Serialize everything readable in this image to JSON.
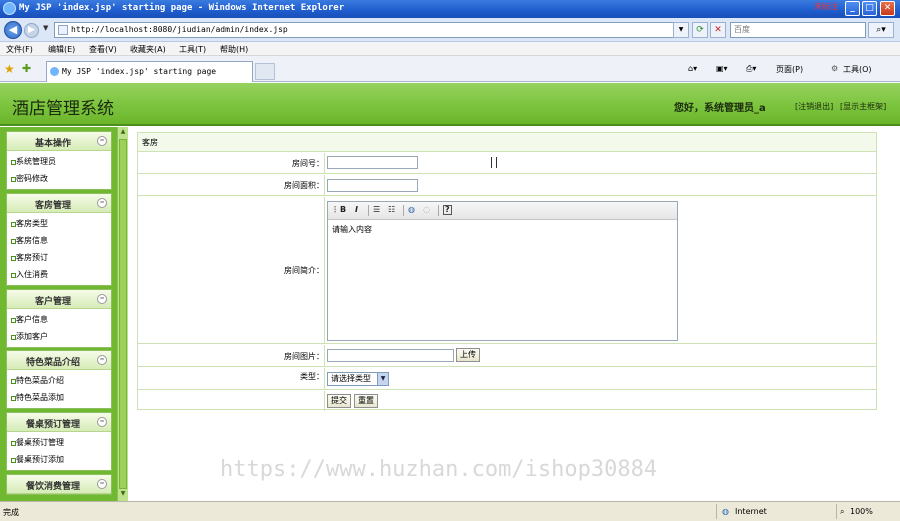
{
  "window": {
    "title": "My JSP 'index.jsp' starting page - Windows Internet Explorer",
    "corner_tag": "未标注",
    "controls": [
      "_",
      "□",
      "✕"
    ]
  },
  "browser": {
    "url": "http://localhost:8080/jiudian/admin/index.jsp",
    "search_placeholder": "百度",
    "menu": [
      "文件(F)",
      "编辑(E)",
      "查看(V)",
      "收藏夹(A)",
      "工具(T)",
      "帮助(H)"
    ],
    "tab_title": "My JSP 'index.jsp' starting page",
    "tools": {
      "page": "页面(P)",
      "tools": "工具(O)"
    },
    "status": {
      "left": "完成",
      "zone": "Internet",
      "zoom": "100%"
    }
  },
  "header": {
    "site_title": "酒店管理系统",
    "greeting": "您好，系统管理员_a",
    "logout": "[注销退出]",
    "main_frame": "[显示主框架]"
  },
  "sidebar": {
    "groups": [
      {
        "title": "基本操作",
        "items": [
          "系统管理员",
          "密码修改"
        ]
      },
      {
        "title": "客房管理",
        "items": [
          "客房类型",
          "客房信息",
          "客房预订",
          "入住消费"
        ]
      },
      {
        "title": "客户管理",
        "items": [
          "客户信息",
          "添加客户"
        ]
      },
      {
        "title": "特色菜品介绍",
        "items": [
          "特色菜品介绍",
          "特色菜品添加"
        ]
      },
      {
        "title": "餐桌预订管理",
        "items": [
          "餐桌预订管理",
          "餐桌预订添加"
        ]
      },
      {
        "title": "餐饮消费管理",
        "items": []
      }
    ]
  },
  "form": {
    "panel_title": "客房",
    "room_no_label": "房间号：",
    "room_area_label": "房间面积：",
    "room_desc_label": "房间简介：",
    "editor_placeholder": "请输入内容",
    "room_image_label": "房间图片：",
    "upload_label": "上传",
    "type_label": "类型：",
    "type_selected": "请选择类型",
    "submit_label": "提交",
    "reset_label": "重置"
  },
  "watermark": "https://www.huzhan.com/ishop30884"
}
